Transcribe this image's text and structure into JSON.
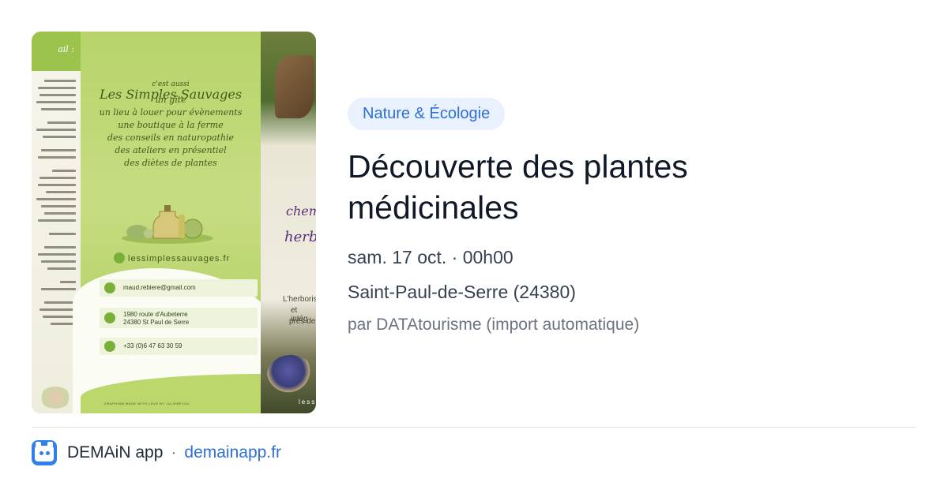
{
  "event": {
    "category": "Nature & Écologie",
    "title": "Découverte des plantes médicinales",
    "date_time": "sam. 17 oct. · 00h00",
    "location": "Saint-Paul-de-Serre (24380)",
    "source": "par DATAtourisme (import automatique)"
  },
  "flyer": {
    "left_header": "ail :",
    "script_title": "Les Simples Sauvages",
    "script_subtitle": "c'est aussi",
    "script_lines": [
      "un gîte",
      "un lieu à louer pour évènements",
      "une boutique à la ferme",
      "des conseils en naturopathie",
      "des ateliers en présentiel",
      "des diètes de plantes"
    ],
    "website": "lessimplessauvages.fr",
    "email": "maud.rebiere@gmail.com",
    "address_line1": "1980 route d'Aubeterre",
    "address_line2": "24380 St Paul de Serre",
    "phone": "+33 (0)6 47 63 30 59",
    "credits": "GRAPHISM MADE WITH LOVE BY JULIEBEYOU",
    "right_purple_1": "chem",
    "right_purple_2": "herbo",
    "right_text_1": "L'herboris",
    "right_text_2": "et intég",
    "right_text_3": "près de",
    "right_brand": "less"
  },
  "footer": {
    "app_name": "DEMAiN app",
    "separator": "·",
    "domain": "demainapp.fr",
    "icon": "demain-app-icon"
  },
  "colors": {
    "tag_bg": "#e8f1fd",
    "tag_text": "#2f6fd6",
    "link": "#2f6fd6",
    "app_icon_bg": "#2f80ed"
  }
}
